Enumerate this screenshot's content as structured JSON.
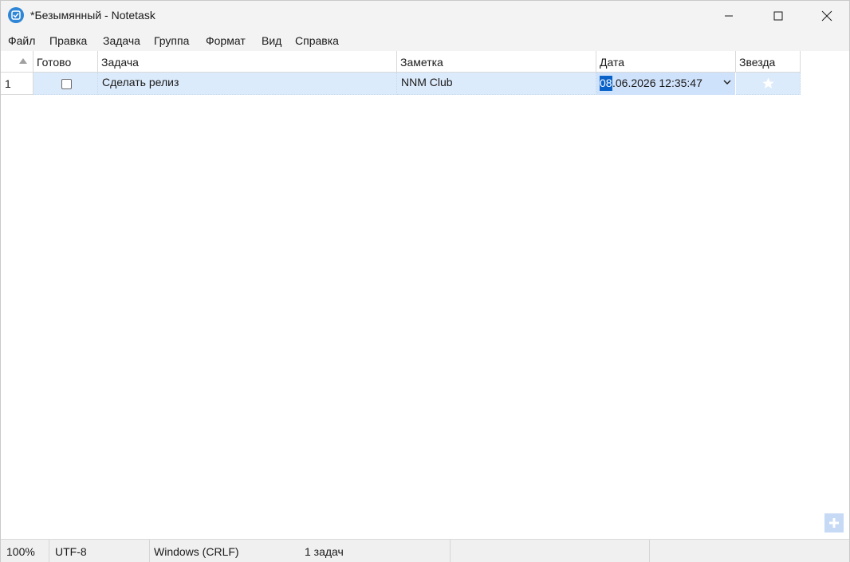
{
  "window": {
    "title": "*Безымянный - Notetask"
  },
  "menu": [
    "Файл",
    "Правка",
    "Задача",
    "Группа",
    "Формат",
    "Вид",
    "Справка"
  ],
  "grid": {
    "columns": [
      "Готово",
      "Задача",
      "Заметка",
      "Дата",
      "Звезда"
    ],
    "rows": [
      {
        "number": "1",
        "done": false,
        "task": "Сделать релиз",
        "note": "NNM Club",
        "date_selected": "08",
        "date_rest": ".06.2026 12:35:47",
        "starred": false
      }
    ]
  },
  "status": {
    "zoom": "100%",
    "encoding": "UTF-8",
    "line_endings": "Windows (CRLF)",
    "task_count": "1 задач"
  },
  "icons": {
    "app": "notetask-check-icon",
    "add": "plus-icon",
    "star": "star-icon",
    "sort": "sort-ascending-icon"
  },
  "colors": {
    "selection_row": "#dcebfb",
    "selection_text": "#0a62c8",
    "app_icon": "#2f86d6"
  }
}
